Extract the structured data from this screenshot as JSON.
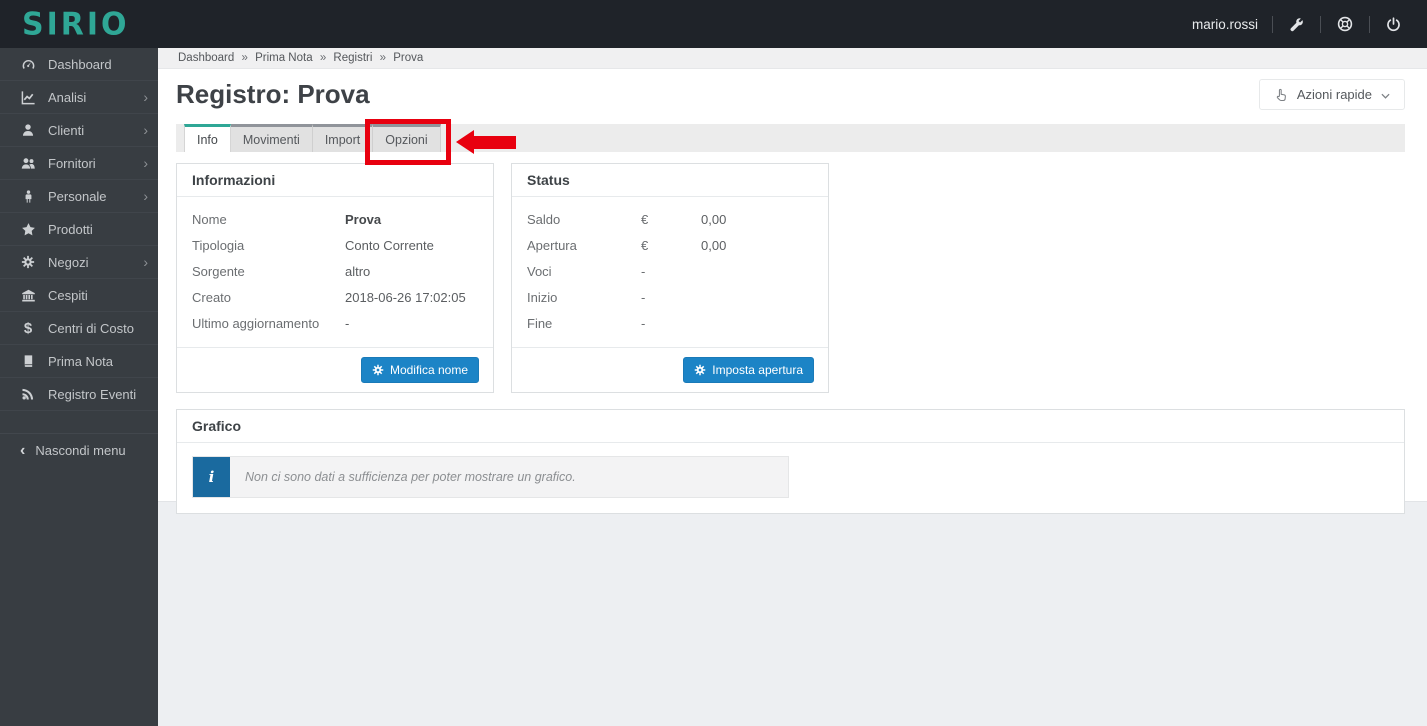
{
  "topbar": {
    "logo": "SIRIO",
    "username": "mario.rossi"
  },
  "sidebar": {
    "items": [
      {
        "label": "Dashboard",
        "submenu": false
      },
      {
        "label": "Analisi",
        "submenu": true
      },
      {
        "label": "Clienti",
        "submenu": true
      },
      {
        "label": "Fornitori",
        "submenu": true
      },
      {
        "label": "Personale",
        "submenu": true
      },
      {
        "label": "Prodotti",
        "submenu": false
      },
      {
        "label": "Negozi",
        "submenu": true
      },
      {
        "label": "Cespiti",
        "submenu": false
      },
      {
        "label": "Centri di Costo",
        "submenu": false
      },
      {
        "label": "Prima Nota",
        "submenu": false
      },
      {
        "label": "Registro Eventi",
        "submenu": false
      }
    ],
    "chevron": "›",
    "collapse_chevron": "‹",
    "collapse_label": "Nascondi menu",
    "dollar_glyph": "$"
  },
  "breadcrumb": {
    "separator": "»",
    "items": [
      "Dashboard",
      "Prima Nota",
      "Registri",
      "Prova"
    ]
  },
  "page": {
    "title": "Registro: Prova"
  },
  "quick_actions": {
    "label": "Azioni rapide"
  },
  "tabs": [
    {
      "label": "Info",
      "active": true
    },
    {
      "label": "Movimenti",
      "active": false
    },
    {
      "label": "Import",
      "active": false
    },
    {
      "label": "Opzioni",
      "active": false,
      "annotated": true
    }
  ],
  "annotation": {
    "type": "red-rectangle-with-arrow",
    "target_tab": "Opzioni"
  },
  "informazioni": {
    "title": "Informazioni",
    "rows": [
      {
        "label": "Nome",
        "value": "Prova"
      },
      {
        "label": "Tipologia",
        "value": "Conto Corrente"
      },
      {
        "label": "Sorgente",
        "value": "altro"
      },
      {
        "label": "Creato",
        "value": "2018-06-26 17:02:05"
      },
      {
        "label": "Ultimo aggiornamento",
        "value": "-"
      }
    ],
    "button_label": "Modifica nome"
  },
  "status": {
    "title": "Status",
    "rows": [
      {
        "label": "Saldo",
        "symbol": "€",
        "value": "0,00"
      },
      {
        "label": "Apertura",
        "symbol": "€",
        "value": "0,00"
      },
      {
        "label": "Voci",
        "symbol": "-",
        "value": ""
      },
      {
        "label": "Inizio",
        "symbol": "-",
        "value": ""
      },
      {
        "label": "Fine",
        "symbol": "-",
        "value": ""
      }
    ],
    "button_label": "Imposta apertura"
  },
  "grafico": {
    "title": "Grafico",
    "info_icon": "i",
    "message": "Non ci sono dati a sufficienza per poter mostrare un grafico."
  },
  "colors": {
    "accent_teal": "#2fa796",
    "button_blue": "#1c84c6",
    "alert_icon_blue": "#1a6a9f",
    "annotation_red": "#e8000f",
    "topbar_bg": "#1f2329",
    "sidebar_bg": "#383d42"
  }
}
